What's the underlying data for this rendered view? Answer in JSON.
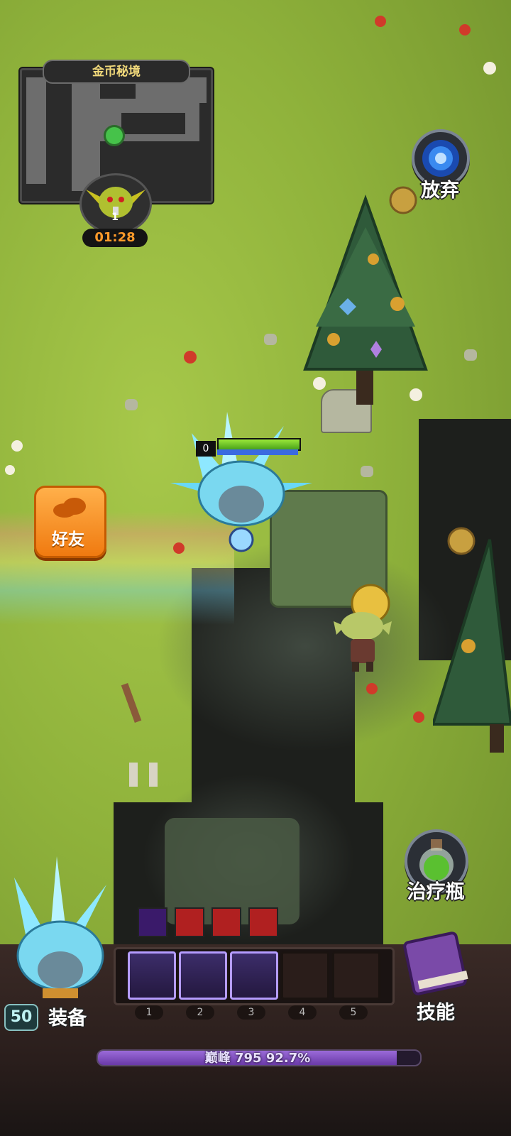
{
  "minimap": {
    "title": "金币秘境"
  },
  "boss": {
    "count": "1",
    "timer": "01:28"
  },
  "right_buttons": {
    "abandon_label": "放弃",
    "heal_label": "治疗瓶"
  },
  "friend": {
    "label": "好友"
  },
  "hero": {
    "shield_value": "0",
    "hp_fraction": 1.0,
    "mp_fraction": 1.0
  },
  "hud": {
    "level": "50",
    "equip_label": "装备",
    "skill_label": "技能",
    "skill_slots": [
      {
        "num": "1",
        "icon": "light-beam-icon",
        "filled": true
      },
      {
        "num": "2",
        "icon": "golden-dome-icon",
        "filled": true
      },
      {
        "num": "3",
        "icon": "meteor-shower-icon",
        "filled": true
      },
      {
        "num": "4",
        "icon": "",
        "filled": false
      },
      {
        "num": "5",
        "icon": "",
        "filled": false
      }
    ],
    "buffs": [
      "purple-gem-buff-icon",
      "red-totem-buff-icon",
      "red-totem-buff-icon",
      "red-totem-buff-icon"
    ],
    "xp": {
      "text": "巅峰 795 92.7%",
      "fraction": 0.927
    }
  },
  "colors": {
    "grass": "#8fb23b",
    "accent_orange": "#f07a10",
    "xp_purple": "#8a5ad0"
  }
}
